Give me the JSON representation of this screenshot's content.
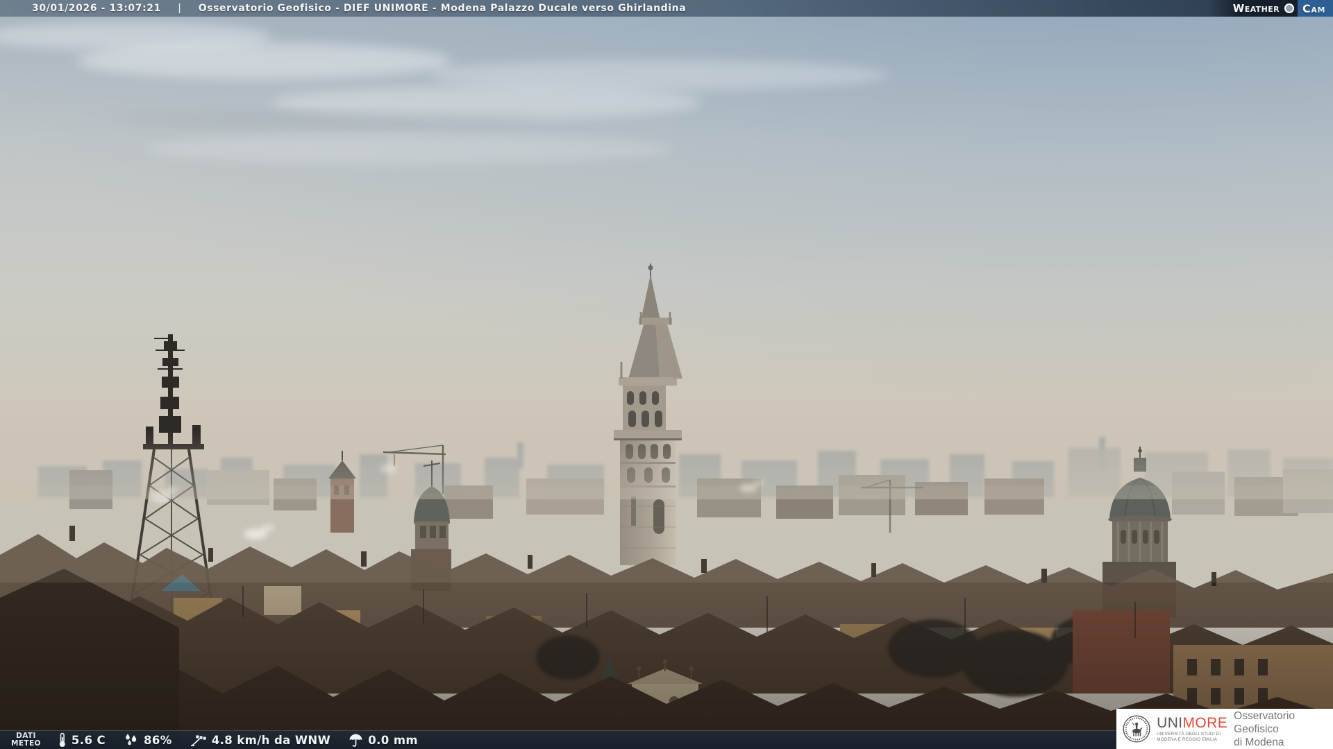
{
  "top_bar": {
    "datetime": "30/01/2026 - 13:07:21",
    "separator": "|",
    "title": "Osservatorio Geofisico - DIEF UNIMORE - Modena Palazzo Ducale verso Ghirlandina",
    "weathercam": {
      "weather": "Weather",
      "cam": "Cam"
    }
  },
  "weather_bar": {
    "label": {
      "line1": "DATI",
      "line2": "METEO"
    },
    "readings": [
      {
        "name": "temperature",
        "icon": "thermometer-icon",
        "value": "5.6 C"
      },
      {
        "name": "humidity",
        "icon": "drops-icon",
        "value": "86%"
      },
      {
        "name": "wind",
        "icon": "windsock-icon",
        "value": "4.8 km/h da WNW"
      },
      {
        "name": "precipitation",
        "icon": "umbrella-icon",
        "value": "0.0 mm"
      }
    ]
  },
  "branding": {
    "acronym_primary": "UNI",
    "acronym_accent": "MORE",
    "university_line1": "UNIVERSITÀ DEGLI STUDI DI",
    "university_line2": "MODENA E REGGIO EMILIA",
    "observatory_line1": "Osservatorio Geofisico",
    "observatory_line2": "di Modena"
  },
  "colors": {
    "accent_red": "#df4b33",
    "cam_badge_blue": "#2d5f95",
    "overlay_navy": "#152a44"
  }
}
